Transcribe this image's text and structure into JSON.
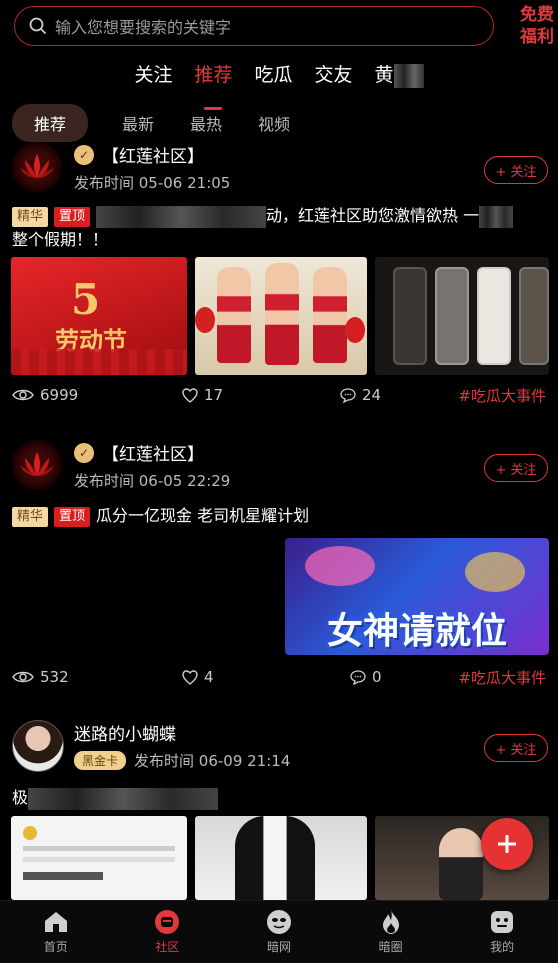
{
  "search": {
    "placeholder": "输入您想要搜索的关键字"
  },
  "promo": {
    "line1": "免费",
    "line2": "福利"
  },
  "top_tabs": [
    "关注",
    "推荐",
    "吃瓜",
    "交友",
    "黄"
  ],
  "sub_tabs": [
    "推荐",
    "最新",
    "最热",
    "视频"
  ],
  "posts": [
    {
      "author": "【红莲社区】",
      "time": "发布时间 05-06 21:05",
      "follow": "+ 关注",
      "tags": [
        "精华",
        "置顶"
      ],
      "title_visible": "动，红莲社区助您激情欲热 一",
      "title_line2": "整个假期！！",
      "views": "6999",
      "likes": "17",
      "comments": "24",
      "topic": "#吃瓜大事件",
      "image1_text_top": "5",
      "image1_text": "劳动节"
    },
    {
      "author": "【红莲社区】",
      "time": "发布时间 06-05 22:29",
      "follow": "+ 关注",
      "tags": [
        "精华",
        "置顶"
      ],
      "title": "瓜分一亿现金 老司机星耀计划",
      "views": "532",
      "likes": "4",
      "comments": "0",
      "topic": "#吃瓜大事件",
      "banner_text": "女神请就位"
    },
    {
      "author": "迷路的小蝴蝶",
      "badge": "黑金卡",
      "time": "发布时间 06-09 21:14",
      "follow": "+ 关注",
      "title_visible": "极"
    }
  ],
  "bottom_nav": [
    "首页",
    "社区",
    "暗网",
    "暗圈",
    "我的"
  ],
  "colors": {
    "accent": "#e03a3a",
    "background": "#000000"
  }
}
